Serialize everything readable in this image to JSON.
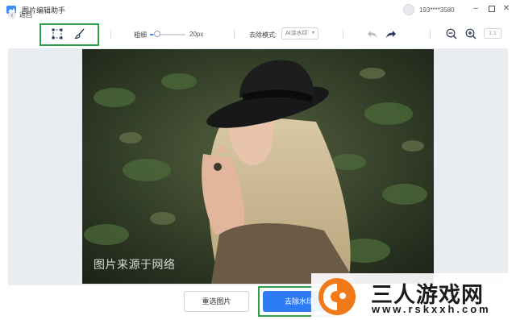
{
  "app": {
    "title": "图片编辑助手",
    "user": "193****3580",
    "window_controls": [
      "minimize-icon",
      "maximize-icon",
      "close-icon"
    ]
  },
  "toolbar": {
    "back_label": "返回",
    "tools": [
      {
        "name": "rect-select-icon",
        "active": true
      },
      {
        "name": "brush-icon",
        "active": false
      }
    ],
    "brush_size_label": "粗细",
    "brush_size_value": "20px",
    "brush_size_level": 0.1,
    "mode_label": "去除模式:",
    "mode_value": "AI涂水印",
    "ratio_label": "1:1"
  },
  "canvas": {
    "watermark_text": "图片来源于网络"
  },
  "footer": {
    "reselect_label": "重选图片",
    "remove_label": "去除水印"
  },
  "site_watermark": {
    "name": "三人游戏网",
    "url": "www.rskxxh.com"
  },
  "colors": {
    "accent": "#2d7cf6",
    "highlight": "#2aa146",
    "canvas_bg": "#e9ecf1",
    "site_orange": "#f07a1a"
  }
}
